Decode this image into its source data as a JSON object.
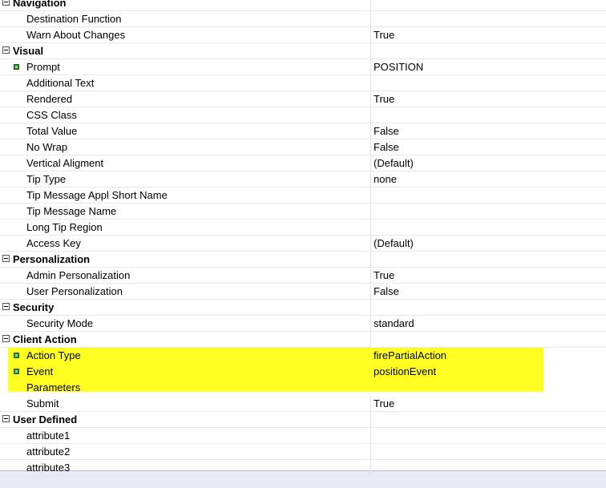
{
  "grid": {
    "rows": [
      {
        "type": "category",
        "label": "Navigation"
      },
      {
        "type": "property",
        "name": "Destination Function",
        "value": ""
      },
      {
        "type": "property",
        "name": "Warn About Changes",
        "value": "True"
      },
      {
        "type": "category",
        "label": "Visual"
      },
      {
        "type": "property",
        "name": "Prompt",
        "value": "POSITION",
        "modified": true
      },
      {
        "type": "property",
        "name": "Additional Text",
        "value": ""
      },
      {
        "type": "property",
        "name": "Rendered",
        "value": "True"
      },
      {
        "type": "property",
        "name": "CSS Class",
        "value": ""
      },
      {
        "type": "property",
        "name": "Total Value",
        "value": "False"
      },
      {
        "type": "property",
        "name": "No Wrap",
        "value": "False"
      },
      {
        "type": "property",
        "name": "Vertical Aligment",
        "value": "(Default)"
      },
      {
        "type": "property",
        "name": "Tip Type",
        "value": "none"
      },
      {
        "type": "property",
        "name": "Tip Message Appl Short Name",
        "value": ""
      },
      {
        "type": "property",
        "name": "Tip Message Name",
        "value": ""
      },
      {
        "type": "property",
        "name": "Long Tip Region",
        "value": ""
      },
      {
        "type": "property",
        "name": "Access Key",
        "value": "(Default)"
      },
      {
        "type": "category",
        "label": "Personalization"
      },
      {
        "type": "property",
        "name": "Admin Personalization",
        "value": "True"
      },
      {
        "type": "property",
        "name": "User Personalization",
        "value": "False"
      },
      {
        "type": "category",
        "label": "Security"
      },
      {
        "type": "property",
        "name": "Security Mode",
        "value": "standard"
      },
      {
        "type": "category",
        "label": "Client Action"
      },
      {
        "type": "property",
        "name": "Action Type",
        "value": "firePartialAction",
        "modified": true,
        "highlighted": true
      },
      {
        "type": "property",
        "name": "Event",
        "value": "positionEvent",
        "modified": true,
        "highlighted": true
      },
      {
        "type": "property",
        "name": "Parameters",
        "value": "",
        "highlighted": true
      },
      {
        "type": "property",
        "name": "Submit",
        "value": "True"
      },
      {
        "type": "category",
        "label": "User Defined"
      },
      {
        "type": "property",
        "name": "attribute1",
        "value": ""
      },
      {
        "type": "property",
        "name": "attribute2",
        "value": ""
      },
      {
        "type": "property",
        "name": "attribute3",
        "value": ""
      }
    ],
    "highlight_color": "#ffff22",
    "modified_marker_color": "#2f8a2f"
  }
}
